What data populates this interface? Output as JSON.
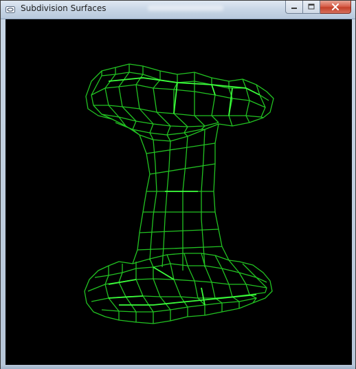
{
  "window": {
    "title": "Subdivision Surfaces",
    "app_icon": "window-app-icon",
    "buttons": [
      {
        "name": "minimize-button",
        "icon": "minimize-icon"
      },
      {
        "name": "maximize-button",
        "icon": "maximize-icon"
      },
      {
        "name": "close-button",
        "icon": "close-icon"
      }
    ]
  },
  "viewport": {
    "background": "#000000",
    "mesh": {
      "type": "wireframe",
      "color": "#22c322",
      "highlight_color": "#3cff3c"
    }
  }
}
